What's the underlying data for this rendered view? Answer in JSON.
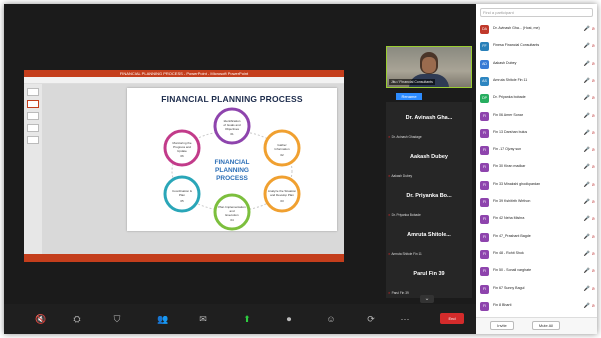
{
  "presentation": {
    "window_title": "FINANCIAL PLANNING PROCESS - PowerPoint - Microsoft PowerPoint",
    "slide_title": "FINANCIAL PLANNING PROCESS",
    "center_label": [
      "FINANCIAL",
      "PLANNING",
      "PROCESS"
    ],
    "steps": [
      {
        "text": [
          "Identification",
          "of Goals and",
          "Objectives"
        ],
        "num": "01"
      },
      {
        "text": [
          "Gather",
          "Information"
        ],
        "num": "02"
      },
      {
        "text": [
          "Analyze the Situation",
          "and Develop Plan"
        ],
        "num": "03"
      },
      {
        "text": [
          "Plan Implementation",
          "and",
          "Execution"
        ],
        "num": "04"
      },
      {
        "text": [
          "Coordination &",
          "Plan"
        ],
        "num": "05"
      },
      {
        "text": [
          "Monitoring the",
          "Progress and",
          "Update"
        ],
        "num": "06"
      }
    ]
  },
  "video": {
    "camera_name": "Jitu / Financial Consultants",
    "rename_label": "Rename",
    "tiles": [
      {
        "name": "Dr. Avinash Gha...",
        "sub": "Dr. Avinash Ghadage"
      },
      {
        "name": "Aakash Dubey",
        "sub": "Aakash Dubey"
      },
      {
        "name": "Dr. Priyanka Bo...",
        "sub": "Dr. Priyanka Bobade"
      },
      {
        "name": "Amruta Shitole...",
        "sub": "Amruta Shitole Fin 11"
      },
      {
        "name": "Parul Fin 39",
        "sub": "Parul Fin 39"
      }
    ]
  },
  "participants": {
    "search_placeholder": "Find a participant",
    "list": [
      {
        "initials": "DA",
        "color": "#c0392b",
        "name": "Dr. Avinash Gha... (Host, me)"
      },
      {
        "initials": "FF",
        "color": "#2980b9",
        "name": "Finesa Financial Consultants"
      },
      {
        "initials": "AD",
        "color": "#3a7bd5",
        "name": "Aakash Dubey"
      },
      {
        "initials": "AS",
        "color": "#2e86c1",
        "name": "Amruta Shitole Fin 11"
      },
      {
        "initials": "DP",
        "color": "#27ae60",
        "name": "Dr. Priyanka bobade"
      },
      {
        "initials": "FI",
        "color": "#8e44ad",
        "name": "Fin 06 Amer Sonar"
      },
      {
        "initials": "FI",
        "color": "#8e44ad",
        "name": "Fin 13 Darshan bulus"
      },
      {
        "initials": "FI",
        "color": "#8e44ad",
        "name": "Fin -17 Ojvay sun"
      },
      {
        "initials": "FI",
        "color": "#8e44ad",
        "name": "Fin 30 Kiran madkar"
      },
      {
        "initials": "FI",
        "color": "#8e44ad",
        "name": "Fin 33 Minakshi ghodkpardan"
      },
      {
        "initials": "FI",
        "color": "#8e44ad",
        "name": "Fin 39 Kshitirth Wirthon"
      },
      {
        "initials": "FI",
        "color": "#8e44ad",
        "name": "Fin 42 Neha Mishra"
      },
      {
        "initials": "FI",
        "color": "#8e44ad",
        "name": "Fin 47_Prashant Bagde"
      },
      {
        "initials": "FI",
        "color": "#8e44ad",
        "name": "Fin 48 - Rohit Shok"
      },
      {
        "initials": "FI",
        "color": "#8e44ad",
        "name": "Fin 50 - Sonali varghate"
      },
      {
        "initials": "FI",
        "color": "#8e44ad",
        "name": "Fin 67 Sunny Bagul"
      },
      {
        "initials": "FI",
        "color": "#8e44ad",
        "name": "Fin 8 Bharti"
      }
    ],
    "invite_label": "Invite",
    "mute_all_label": "Mute All"
  },
  "toolbar": {
    "end_label": "End"
  },
  "colors": {
    "ring_colors": [
      "#f0a030",
      "#f0a030",
      "#7cbf3d",
      "#7cbf3d",
      "#2aa6b8",
      "#c23b8a"
    ],
    "accent": "#2d8cff",
    "end": "#d42b2b"
  }
}
